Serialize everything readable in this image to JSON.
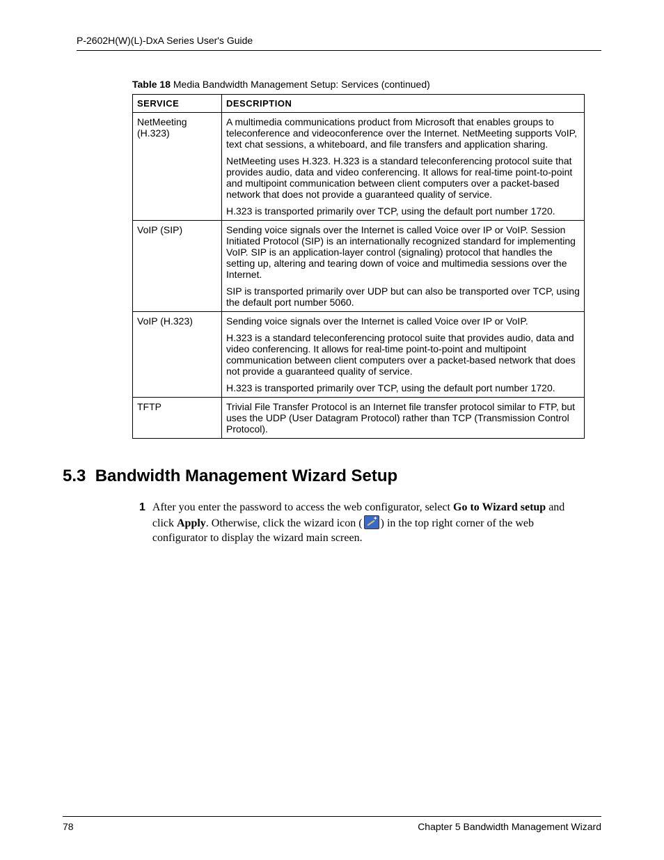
{
  "header": {
    "title": "P-2602H(W)(L)-DxA Series User's Guide"
  },
  "tableCaption": {
    "label": "Table 18",
    "text": "   Media Bandwidth Management Setup: Services (continued)"
  },
  "tableHeaders": {
    "service": "SERVICE",
    "description": "DESCRIPTION"
  },
  "rows": [
    {
      "service": "NetMeeting (H.323)",
      "paras": [
        "A multimedia communications product from Microsoft that enables groups to teleconference and videoconference over the Internet. NetMeeting supports VoIP, text chat sessions, a whiteboard, and file transfers and application sharing.",
        "NetMeeting uses H.323. H.323 is a standard teleconferencing protocol suite that provides audio, data and video conferencing. It allows for real-time point-to-point and multipoint communication between client computers over a packet-based network that does not provide a guaranteed quality of service.",
        "H.323 is transported primarily over TCP, using the default port number 1720."
      ]
    },
    {
      "service": "VoIP (SIP)",
      "paras": [
        "Sending voice signals over the Internet is called Voice over IP or VoIP. Session Initiated Protocol  (SIP) is an internationally recognized standard for implementing VoIP. SIP is an application-layer control (signaling) protocol that handles the setting up, altering and tearing down of voice and multimedia sessions over the Internet.",
        "SIP is transported primarily over UDP but can also be transported over TCP, using the default port number 5060."
      ]
    },
    {
      "service": "VoIP (H.323)",
      "paras": [
        "Sending voice signals over the Internet is called Voice over IP or VoIP.",
        "H.323 is a standard teleconferencing protocol suite that provides audio, data and video conferencing. It allows for real-time point-to-point and multipoint communication between client computers over a packet-based network that does not provide a guaranteed quality of service.",
        "H.323 is transported primarily over TCP, using the default port number 1720."
      ]
    },
    {
      "service": "TFTP",
      "paras": [
        "Trivial File Transfer Protocol is an Internet file transfer protocol similar to FTP, but uses the UDP (User Datagram Protocol) rather than TCP (Transmission Control Protocol)."
      ]
    }
  ],
  "section": {
    "number": "5.3",
    "title": "Bandwidth Management Wizard Setup"
  },
  "step": {
    "num": "1",
    "pre": "After you enter the password to access the web configurator, select ",
    "bold1": "Go to Wizard setup",
    "mid1": " and click ",
    "bold2": "Apply",
    "mid2": ". Otherwise, click the wizard icon (",
    "post": ") in the top right corner of the web configurator to display the wizard main screen."
  },
  "footer": {
    "page": "78",
    "chapter": "Chapter 5 Bandwidth Management Wizard"
  }
}
